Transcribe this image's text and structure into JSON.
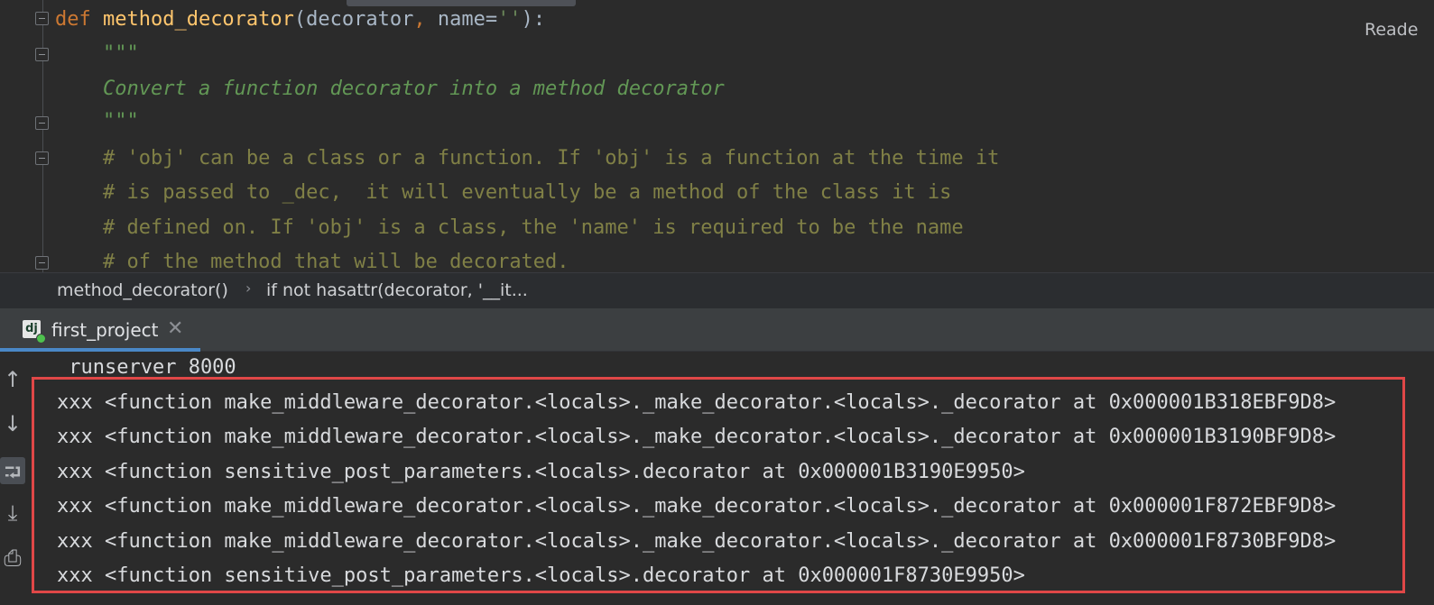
{
  "editor": {
    "lines": [
      {
        "parts": [
          {
            "t": "def ",
            "c": "kw"
          },
          {
            "t": "method_decorator",
            "c": "fn"
          },
          {
            "t": "(decorator",
            "c": ""
          },
          {
            "t": ", ",
            "c": "kw"
          },
          {
            "t": "name=",
            "c": ""
          },
          {
            "t": "''",
            "c": "str"
          },
          {
            "t": "):",
            "c": ""
          }
        ]
      },
      {
        "parts": [
          {
            "t": "    \"\"\"",
            "c": "doc"
          }
        ]
      },
      {
        "parts": [
          {
            "t": "    Convert a function decorator into a method decorator",
            "c": "doc"
          }
        ]
      },
      {
        "parts": [
          {
            "t": "    \"\"\"",
            "c": "doc"
          }
        ]
      },
      {
        "parts": [
          {
            "t": "    # 'obj' can be a class or a function. If 'obj' is a function at the time it",
            "c": "cmt"
          }
        ]
      },
      {
        "parts": [
          {
            "t": "    # is passed to _dec,  it will eventually be a method of the class it is",
            "c": "cmt"
          }
        ]
      },
      {
        "parts": [
          {
            "t": "    # defined on. If 'obj' is a class, the 'name' is required to be the name",
            "c": "cmt"
          }
        ]
      },
      {
        "parts": [
          {
            "t": "    # of the method that will be decorated.",
            "c": "cmt"
          }
        ]
      }
    ],
    "reader_mode_label": "Reade"
  },
  "breadcrumb": {
    "items": [
      "method_decorator()",
      "if not hasattr(decorator, '__it..."
    ]
  },
  "run_panel": {
    "tab_label": "first_project",
    "tab_icon_text": "dj",
    "close_glyph": "✕"
  },
  "console": {
    "lines": [
      " runserver 8000",
      "xxx <function make_middleware_decorator.<locals>._make_decorator.<locals>._decorator at 0x000001B318EBF9D8>",
      "xxx <function make_middleware_decorator.<locals>._make_decorator.<locals>._decorator at 0x000001B3190BF9D8>",
      "xxx <function sensitive_post_parameters.<locals>.decorator at 0x000001B3190E9950>",
      "xxx <function make_middleware_decorator.<locals>._make_decorator.<locals>._decorator at 0x000001F872EBF9D8>",
      "xxx <function make_middleware_decorator.<locals>._make_decorator.<locals>._decorator at 0x000001F8730BF9D8>",
      "xxx <function sensitive_post_parameters.<locals>.decorator at 0x000001F8730E9950>"
    ],
    "toolbar": [
      {
        "icon": "arrow-up-icon",
        "glyph": "↑"
      },
      {
        "icon": "arrow-down-icon",
        "glyph": "↓"
      },
      {
        "icon": "soft-wrap-icon",
        "glyph": "⮒"
      },
      {
        "icon": "scroll-to-end-icon",
        "glyph": "⤓"
      },
      {
        "icon": "print-icon",
        "glyph": "⎙"
      }
    ]
  },
  "colors": {
    "highlight_border": "#e04747",
    "tab_accent": "#4a88c7"
  }
}
